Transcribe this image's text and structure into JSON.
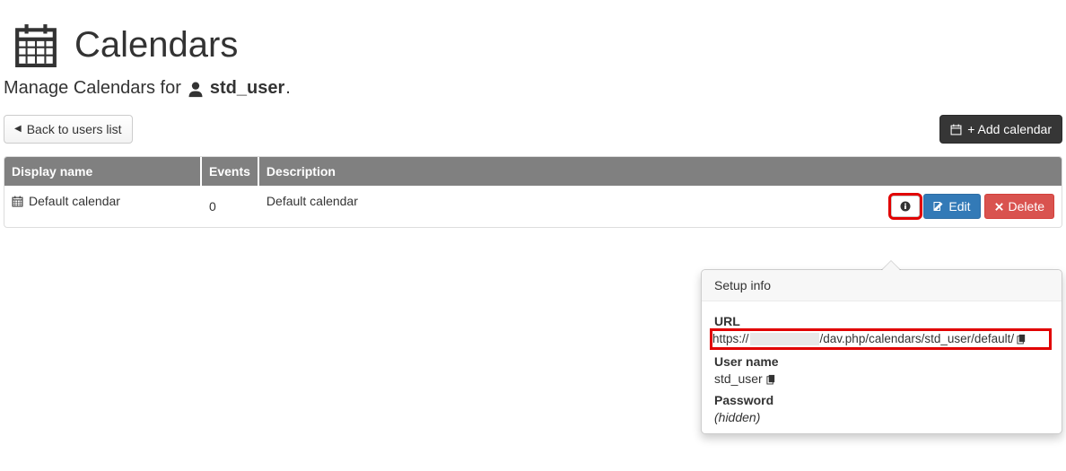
{
  "header": {
    "title": "Calendars"
  },
  "subtitle": {
    "prefix": "Manage Calendars for",
    "username": "std_user",
    "suffix": "."
  },
  "toolbar": {
    "back_label": "Back to users list",
    "add_label": "+ Add calendar"
  },
  "table": {
    "headers": {
      "display": "Display name",
      "events": "Events",
      "description": "Description"
    },
    "rows": [
      {
        "display": "Default calendar",
        "events": "0",
        "description": "Default calendar"
      }
    ],
    "actions": {
      "edit": "Edit",
      "delete": "Delete"
    }
  },
  "popover": {
    "title": "Setup info",
    "url_label": "URL",
    "url_prefix": "https://",
    "url_suffix": "/dav.php/calendars/std_user/default/",
    "user_label": "User name",
    "user_value": "std_user",
    "password_label": "Password",
    "password_value": "(hidden)"
  }
}
